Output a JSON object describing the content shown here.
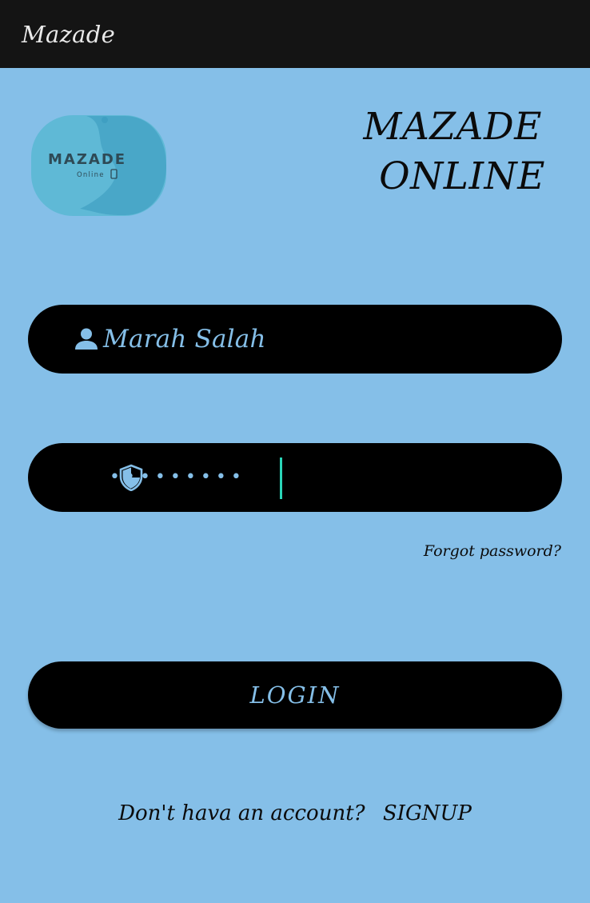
{
  "app_bar": {
    "title": "Mazade"
  },
  "logo": {
    "word": "MAZADE",
    "sub": "Online",
    "icon": "mazade-logo"
  },
  "brand": {
    "line1": "MAZADE",
    "line2": "ONLINE"
  },
  "form": {
    "username": {
      "value": "Marah Salah",
      "icon": "person-icon"
    },
    "password": {
      "masked_value": "•••••••••",
      "icon": "shield-icon"
    },
    "forgot_password_label": "Forgot password?",
    "login_label": "LOGIN",
    "signup_prompt": "Don't hava an account?",
    "signup_label": "SIGNUP"
  },
  "colors": {
    "background": "#85bfe8",
    "app_bar": "#141414",
    "field": "#000000",
    "accent_text": "#85bfe8",
    "caret": "#2ad5b8"
  }
}
